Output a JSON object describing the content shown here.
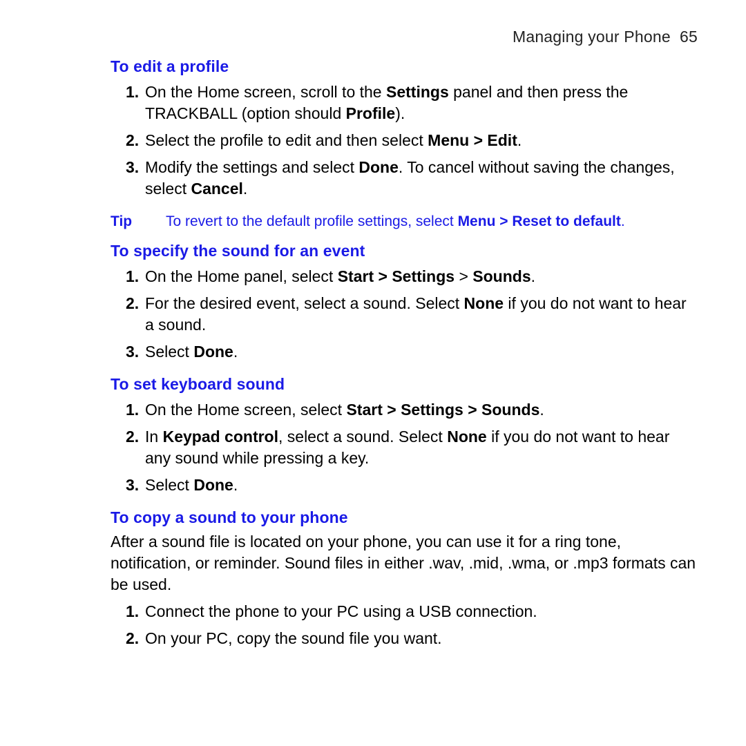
{
  "runhead": {
    "title": "Managing your Phone",
    "pagenum": "65"
  },
  "sec1": {
    "head": "To edit a profile",
    "s1a": "On the Home screen, scroll to the ",
    "s1b": "Settings",
    "s1c": " panel and then press the TRACKBALL (option should ",
    "s1d": "Profile",
    "s1e": ").",
    "s2a": "Select the profile to edit and then select ",
    "s2b": "Menu > Edit",
    "s2c": ".",
    "s3a": "Modify the settings and select ",
    "s3b": "Done",
    "s3c": ". To cancel without saving the changes, select ",
    "s3d": "Cancel",
    "s3e": "."
  },
  "tip": {
    "label": "Tip",
    "t1": "To revert to the default profile settings, select ",
    "t2": "Menu > Reset to default",
    "t3": "."
  },
  "sec2": {
    "head": "To specify the sound for an event",
    "s1a": "On the Home panel, select ",
    "s1b": "Start > Settings",
    "s1c": " > ",
    "s1d": "Sounds",
    "s1e": ".",
    "s2a": "For the desired event, select a sound. Select ",
    "s2b": "None",
    "s2c": " if you do not want to hear a sound.",
    "s3a": "Select ",
    "s3b": "Done",
    "s3c": "."
  },
  "sec3": {
    "head": "To set keyboard sound",
    "s1a": "On the Home screen, select ",
    "s1b": "Start > Settings > Sounds",
    "s1c": ".",
    "s2a": "In ",
    "s2b": "Keypad control",
    "s2c": ", select a sound. Select ",
    "s2d": "None",
    "s2e": " if you do not want to hear any sound while pressing a key.",
    "s3a": "Select ",
    "s3b": "Done",
    "s3c": "."
  },
  "sec4": {
    "head": "To copy a sound to your phone",
    "intro": "After a sound file is located on your phone, you can use it for a ring tone, notification, or reminder. Sound files in either .wav, .mid, .wma, or .mp3 formats can be used.",
    "s1": "Connect the phone to your PC using a USB connection.",
    "s2": "On your PC, copy the sound file you want."
  }
}
